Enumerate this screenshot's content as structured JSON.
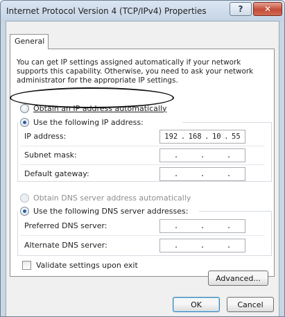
{
  "window": {
    "title": "Internet Protocol Version 4 (TCP/IPv4) Properties",
    "help_label": "?",
    "close_label": "✕"
  },
  "tabs": [
    {
      "label": "General",
      "selected": true
    }
  ],
  "description": "You can get IP settings assigned automatically if your network supports this capability. Otherwise, you need to ask your network administrator for the appropriate IP settings.",
  "ip": {
    "auto_label": "Obtain an IP address automatically",
    "manual_label": "Use the following IP address:",
    "selected": "manual",
    "fields": [
      {
        "label": "IP address:",
        "octets": [
          "192",
          "168",
          "10",
          "55"
        ]
      },
      {
        "label": "Subnet mask:",
        "octets": [
          ".",
          ".",
          "."
        ]
      },
      {
        "label": "Default gateway:",
        "octets": [
          ".",
          ".",
          "."
        ]
      }
    ]
  },
  "dns": {
    "auto_label": "Obtain DNS server address automatically",
    "manual_label": "Use the following DNS server addresses:",
    "selected": "manual",
    "fields": [
      {
        "label": "Preferred DNS server:",
        "octets": [
          ".",
          ".",
          "."
        ]
      },
      {
        "label": "Alternate DNS server:",
        "octets": [
          ".",
          ".",
          "."
        ]
      }
    ]
  },
  "validate_label": "Validate settings upon exit",
  "advanced_label": "Advanced...",
  "ok_label": "OK",
  "cancel_label": "Cancel"
}
